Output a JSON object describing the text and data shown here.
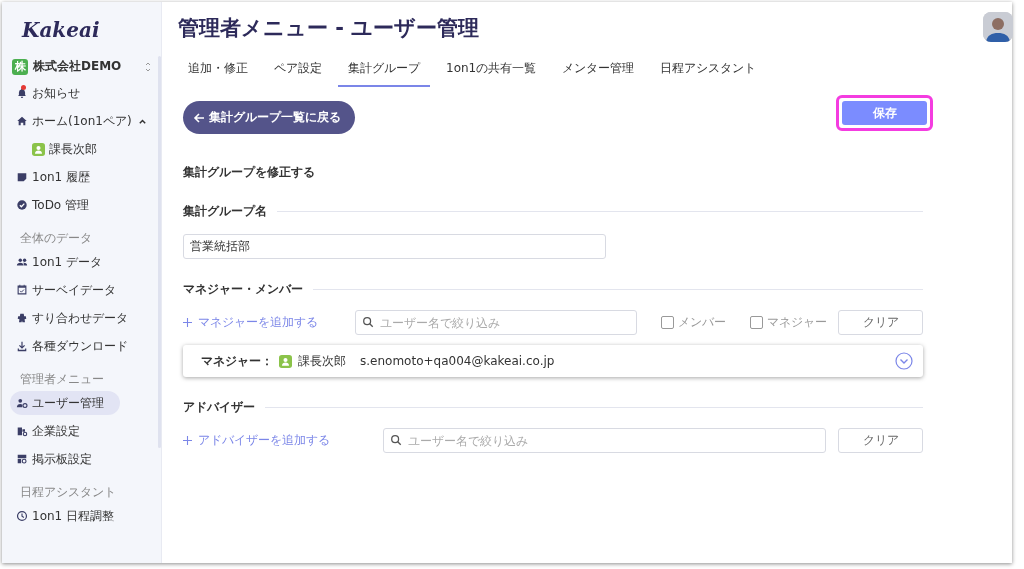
{
  "sidebar": {
    "logo": "Kakeai",
    "org": {
      "badge": "株",
      "name": "株式会社DEMO"
    },
    "sections": [
      {
        "items": [
          {
            "label": "お知らせ",
            "unread": true,
            "selected": false
          },
          {
            "label": "ホーム(1on1ペア)",
            "expanded": true,
            "selected": false,
            "children": [
              {
                "label": "課長次郎",
                "selected": false
              }
            ]
          },
          {
            "label": "1on1 履歴",
            "selected": false
          },
          {
            "label": "ToDo 管理",
            "selected": false
          }
        ]
      },
      {
        "title": "全体のデータ",
        "items": [
          {
            "label": "1on1 データ",
            "selected": false
          },
          {
            "label": "サーベイデータ",
            "selected": false
          },
          {
            "label": "すり合わせデータ",
            "selected": false
          },
          {
            "label": "各種ダウンロード",
            "selected": false
          }
        ]
      },
      {
        "title": "管理者メニュー",
        "items": [
          {
            "label": "ユーザー管理",
            "selected": true
          },
          {
            "label": "企業設定",
            "selected": false
          },
          {
            "label": "掲示板設定",
            "selected": false
          }
        ]
      },
      {
        "title": "日程アシスタント",
        "items": [
          {
            "label": "1on1 日程調整",
            "selected": false
          }
        ]
      }
    ]
  },
  "page": {
    "title": "管理者メニュー - ユーザー管理",
    "tabs": [
      {
        "label": "追加・修正",
        "selected": false
      },
      {
        "label": "ペア設定",
        "selected": false
      },
      {
        "label": "集計グループ",
        "selected": true
      },
      {
        "label": "1on1の共有一覧",
        "selected": false
      },
      {
        "label": "メンター管理",
        "selected": false
      },
      {
        "label": "日程アシスタント",
        "selected": false
      }
    ],
    "back_button": "集計グループ一覧に戻る",
    "save_button": {
      "label": "保存",
      "highlighted": true
    },
    "heading": "集計グループを修正する",
    "group_name": {
      "label": "集計グループ名",
      "value": "営業統括部"
    },
    "managers": {
      "title": "マネジャー・メンバー",
      "add_link": "マネジャーを追加する",
      "search": {
        "placeholder": "ユーザー名で絞り込み"
      },
      "filters": [
        {
          "label": "メンバー",
          "checked": false
        },
        {
          "label": "マネジャー",
          "checked": false
        }
      ],
      "clear": "クリア",
      "members": [
        {
          "role": "マネジャー：",
          "name": "課長次郎",
          "email": "s.enomoto+qa004@kakeai.co.jp"
        }
      ]
    },
    "advisors": {
      "title": "アドバイザー",
      "add_link": "アドバイザーを追加する",
      "search": {
        "placeholder": "ユーザー名で絞り込み"
      },
      "clear": "クリア"
    }
  }
}
